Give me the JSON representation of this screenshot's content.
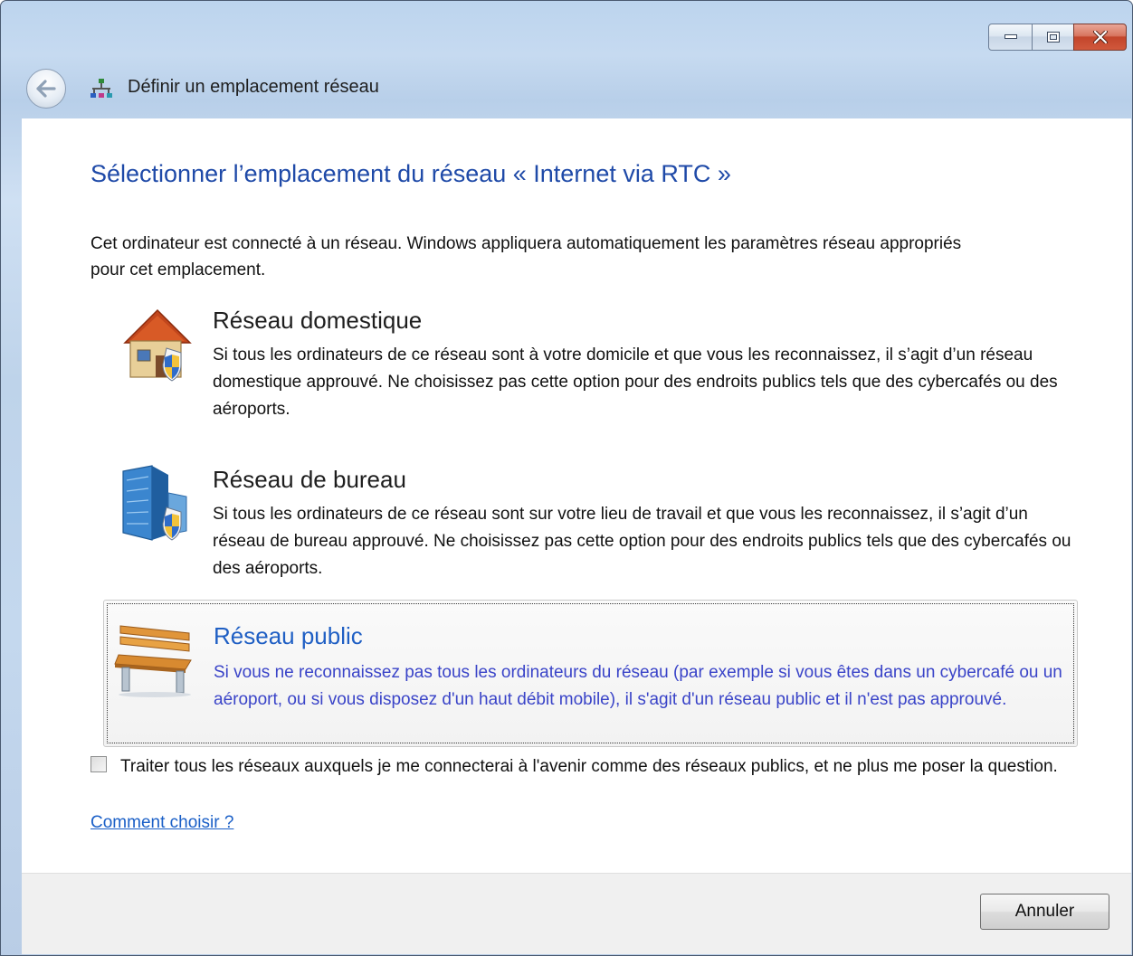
{
  "window": {
    "title": "Définir un emplacement réseau",
    "controls": {
      "minimize": "minimize-icon",
      "maximize": "maximize-icon",
      "close": "close-icon"
    }
  },
  "main": {
    "heading": "Sélectionner l’emplacement du réseau « Internet via RTC »",
    "intro": "Cet ordinateur est connecté à un réseau. Windows appliquera automatiquement les paramètres réseau appropriés pour cet emplacement.",
    "options": [
      {
        "title": "Réseau domestique",
        "description": "Si tous les ordinateurs de ce réseau sont à votre domicile et que vous les reconnaissez, il s’agit d’un réseau domestique approuvé. Ne choisissez pas cette option pour des endroits publics tels que des cybercafés ou des aéroports.",
        "icon": "house-shield-icon"
      },
      {
        "title": "Réseau de bureau",
        "description": "Si tous les ordinateurs de ce réseau sont sur votre lieu de travail et que vous les reconnaissez, il s’agit d’un réseau de bureau approuvé. Ne choisissez pas cette option pour des endroits publics tels que des cybercafés ou des aéroports.",
        "icon": "office-building-shield-icon"
      },
      {
        "title": "Réseau public",
        "description": "Si vous ne reconnaissez pas tous les ordinateurs du réseau (par exemple si vous êtes dans un cybercafé ou un aéroport, ou si vous disposez d'un haut débit mobile), il s'agit d'un réseau public et il n'est pas approuvé.",
        "icon": "park-bench-icon",
        "selected": true
      }
    ],
    "checkbox": {
      "label": "Traiter tous les réseaux auxquels je me connecterai à l'avenir comme des réseaux publics, et ne plus me poser la question.",
      "checked": false
    },
    "help_link": "Comment choisir ?"
  },
  "footer": {
    "cancel_label": "Annuler"
  },
  "colors": {
    "heading": "#1f4aa8",
    "selected_title": "#1f5fc4",
    "selected_desc": "#3a44c8",
    "link": "#1a5fc7",
    "close_button": "#c2452b"
  }
}
